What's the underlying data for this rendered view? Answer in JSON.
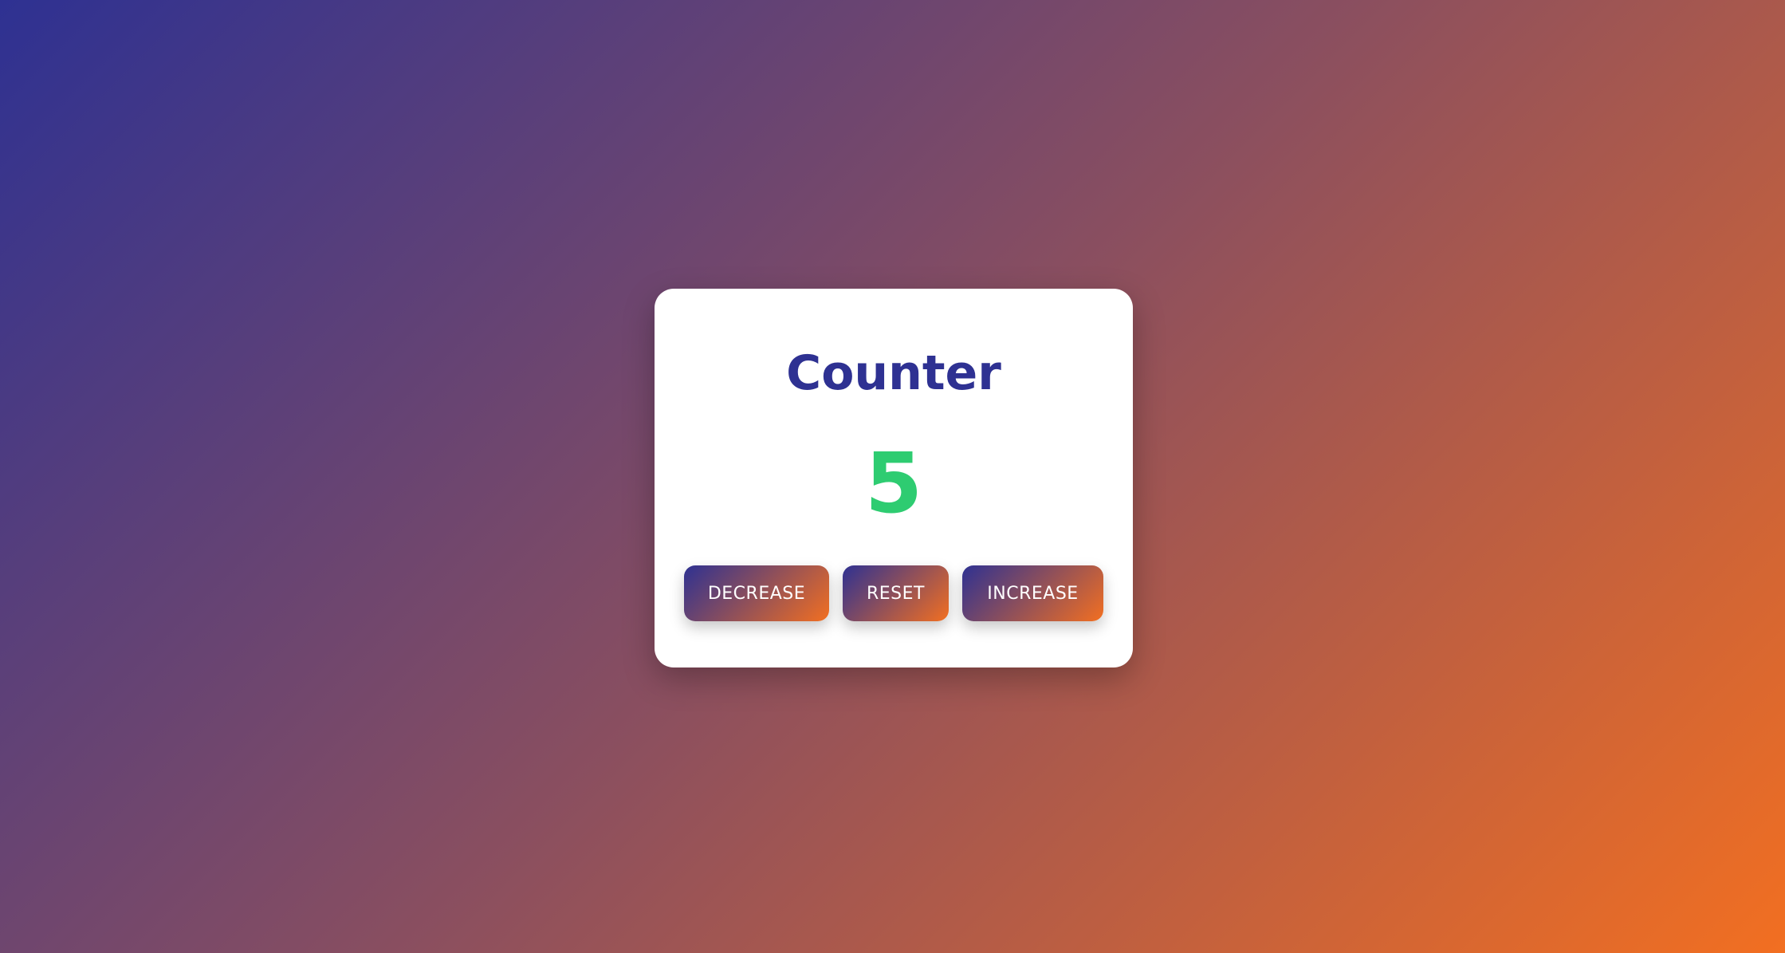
{
  "counter": {
    "title": "Counter",
    "value": "5",
    "buttons": {
      "decrease_label": "DECREASE",
      "reset_label": "RESET",
      "increase_label": "INCREASE"
    }
  },
  "colors": {
    "gradient_start": "#2e3192",
    "gradient_end": "#f26f21",
    "title": "#2e3192",
    "value": "#2ecc71",
    "card": "#ffffff"
  }
}
